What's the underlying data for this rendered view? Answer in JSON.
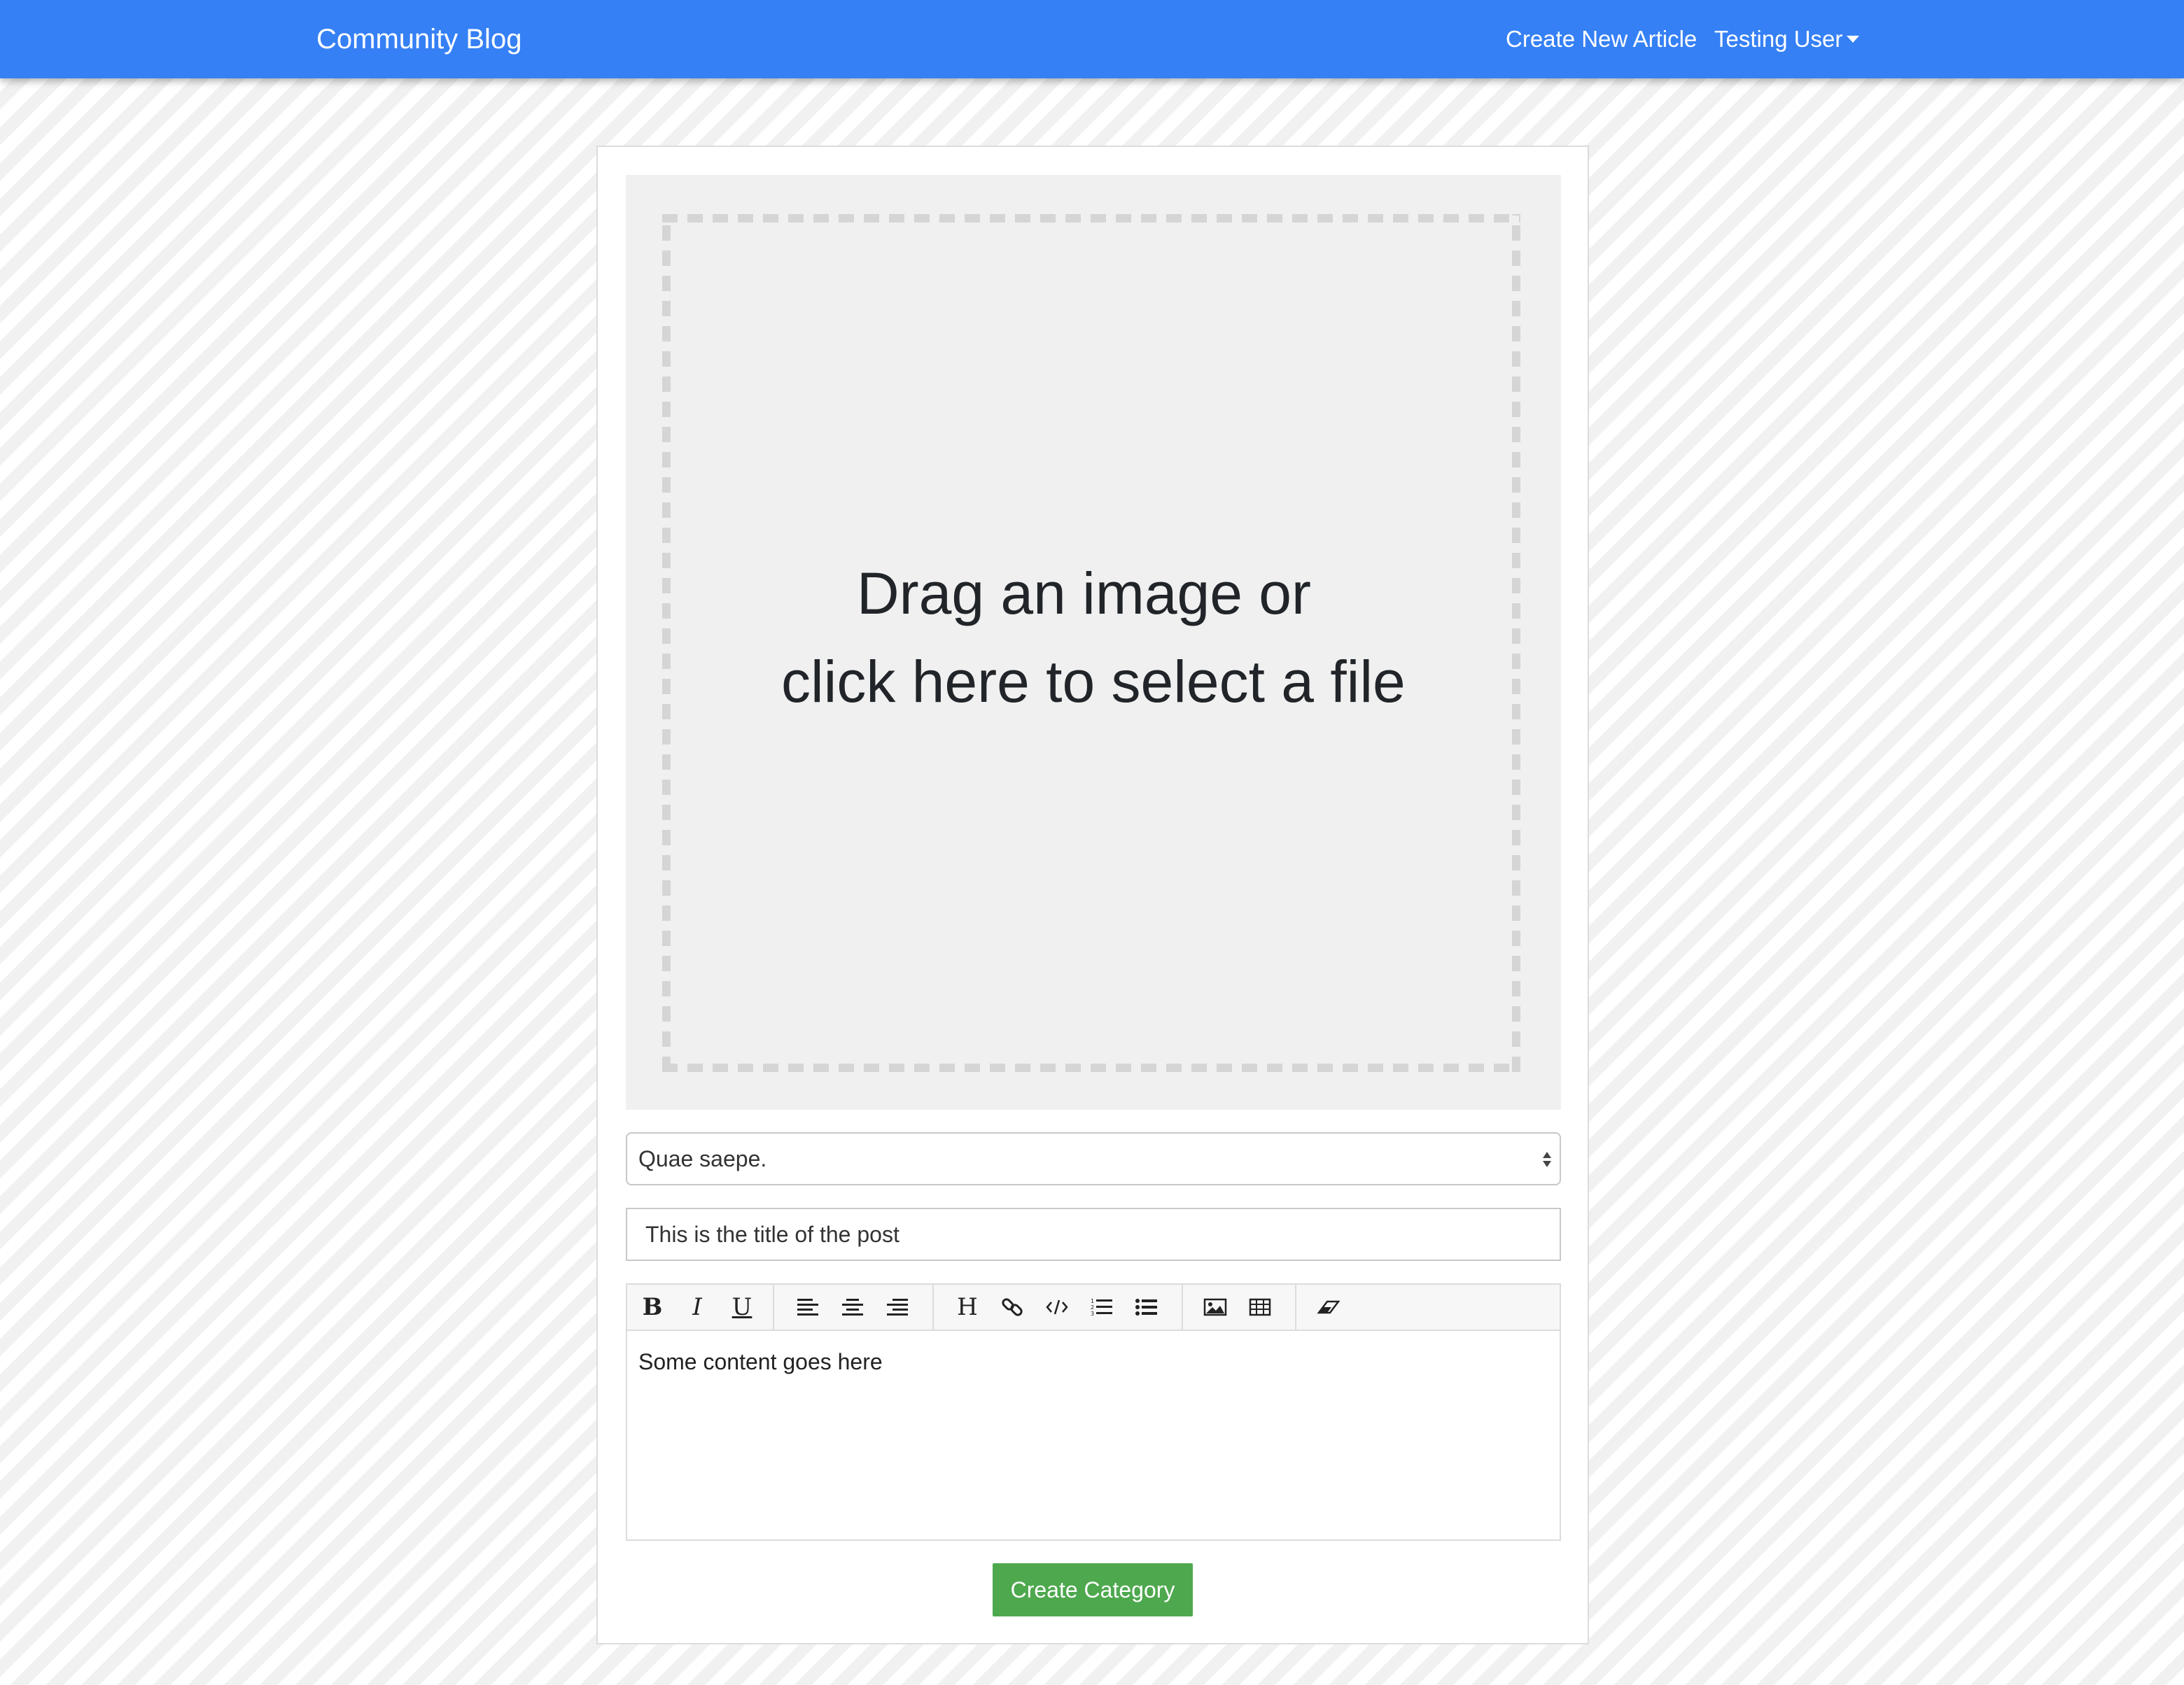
{
  "navbar": {
    "brand": "Community Blog",
    "create_link": "Create New Article",
    "user_menu": "Testing User"
  },
  "dropzone": {
    "line1": "Drag an image or",
    "line2": "click here to select a file"
  },
  "category_select": {
    "value": "Quae saepe."
  },
  "title_input": {
    "value": "This is the title of the post"
  },
  "editor": {
    "toolbar_icons": [
      "bold-icon",
      "italic-icon",
      "underline-icon",
      "align-left-icon",
      "align-center-icon",
      "align-right-icon",
      "heading-icon",
      "link-icon",
      "code-icon",
      "ordered-list-icon",
      "unordered-list-icon",
      "image-icon",
      "table-icon",
      "eraser-icon"
    ],
    "content": "Some content goes here"
  },
  "submit_button": "Create Category",
  "colors": {
    "navbar": "#3580f5",
    "submit": "#4ea84e"
  }
}
